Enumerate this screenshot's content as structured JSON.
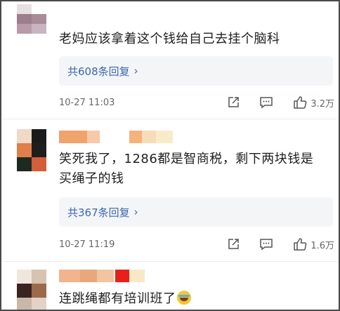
{
  "comments": [
    {
      "text": "老妈应该拿着这个钱给自己去挂个脑科",
      "replies_label": "共608条回复",
      "time": "10-27 11:03",
      "likes": "3.2万"
    },
    {
      "text_line1": "笑死我了，1286都是智商税，剩下两块钱是",
      "text_line2": "买绳子的钱",
      "replies_label": "共367条回复",
      "time": "10-27 11:19",
      "likes": "1.6万"
    },
    {
      "text": "连跳绳都有培训班了"
    }
  ],
  "icons": {
    "reply_chevron": "chevron-right-icon",
    "share": "share-icon",
    "comment": "comment-icon",
    "like": "thumbs-up-icon",
    "emoji": "laugh-cry-emoji-icon"
  },
  "colors": {
    "link": "#3b67b3",
    "reply_bg": "#f4f5f7",
    "meta": "#666666"
  }
}
